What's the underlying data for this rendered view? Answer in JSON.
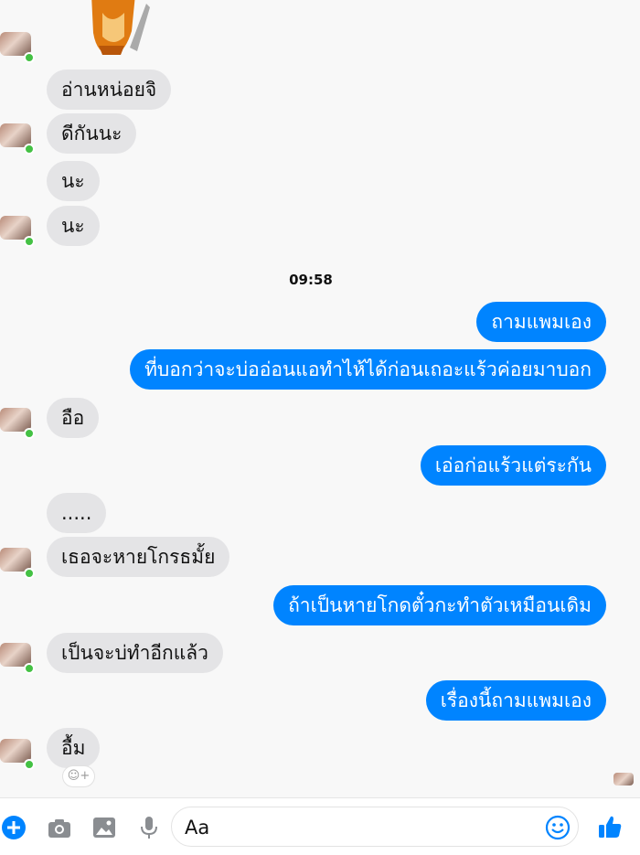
{
  "timestamp": "09:58",
  "messages": [
    {
      "side": "in",
      "text": "อ่านหน่อยจิ"
    },
    {
      "side": "in",
      "text": "ดีกันนะ"
    },
    {
      "side": "in",
      "text": "นะ"
    },
    {
      "side": "in",
      "text": "นะ"
    },
    {
      "side": "out",
      "text": "ถามแพมเอง"
    },
    {
      "side": "out",
      "text": "ที่บอกว่าจะบ่ออ่อนแอทำไห้ได้ก่อนเถอะแร้วค่อยมาบอก"
    },
    {
      "side": "in",
      "text": "อือ"
    },
    {
      "side": "out",
      "text": "เอ่อก่อแร้วแต่ระกัน"
    },
    {
      "side": "in",
      "text": "....."
    },
    {
      "side": "in",
      "text": "เธอจะหายโกรธมั้ย"
    },
    {
      "side": "out",
      "text": "ถ้าเป็นหายโกดตั๋วกะทำตัวเหมือนเดิม"
    },
    {
      "side": "in",
      "text": "เป็นจะบ่ทำอีกแล้ว"
    },
    {
      "side": "out",
      "text": "เรื่องนี้ถามแพมเอง"
    },
    {
      "side": "in",
      "text": "อื้ม"
    }
  ],
  "composer": {
    "placeholder": "Aa",
    "icons": [
      "plus-icon",
      "camera-icon",
      "image-icon",
      "microphone-icon",
      "emoji-icon",
      "thumbs-up-icon"
    ]
  },
  "colors": {
    "accent": "#0084ff",
    "incoming": "#e4e4e6",
    "online": "#44c144"
  }
}
